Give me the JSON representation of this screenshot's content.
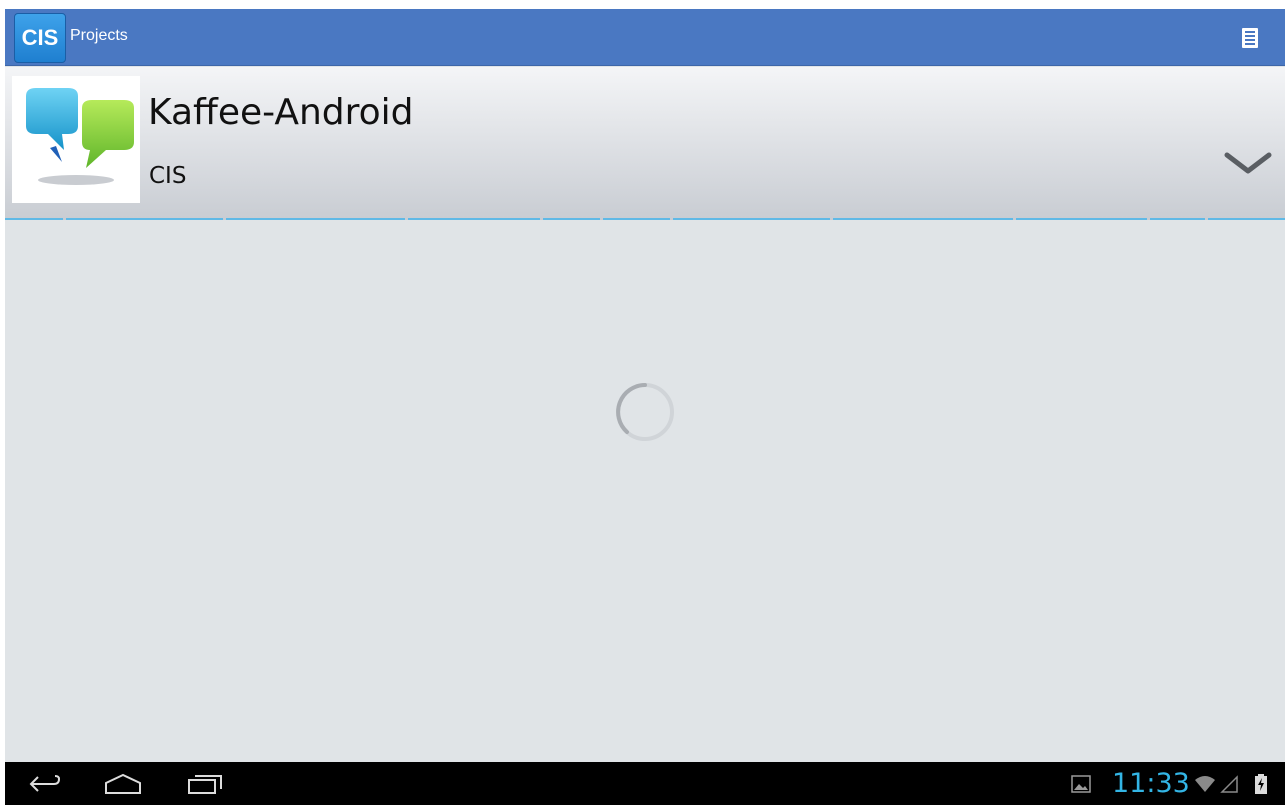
{
  "action_bar": {
    "logo_text": "CIS",
    "title": "Projects",
    "menu_icon": "overflow-menu-icon",
    "color": "#4a78c2"
  },
  "project": {
    "name": "Kaffee-Android",
    "organization": "CIS",
    "thumbnail_icon": "speech-bubbles-icon",
    "expand_icon": "chevron-down-icon"
  },
  "content": {
    "loading": true,
    "spinner_icon": "loading-spinner-icon"
  },
  "system_bar": {
    "time": "11:33",
    "back_icon": "back-icon",
    "home_icon": "home-icon",
    "recents_icon": "recent-apps-icon",
    "notification_icon": "gallery-notification-icon",
    "wifi_icon": "wifi-icon",
    "signal_icon": "signal-icon",
    "battery_icon": "battery-charging-icon",
    "accent": "#33b5e5"
  }
}
